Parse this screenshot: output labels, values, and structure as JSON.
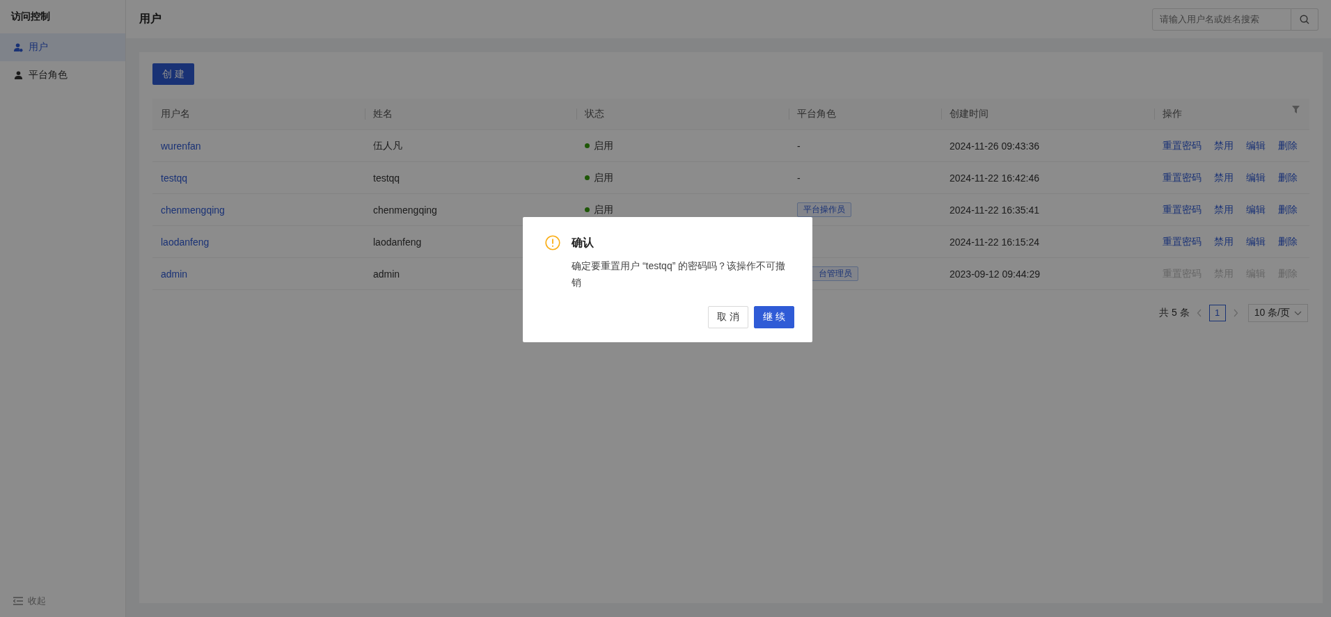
{
  "sidebar": {
    "title": "访问控制",
    "items": [
      {
        "label": "用户",
        "kind": "user",
        "selected": true
      },
      {
        "label": "平台角色",
        "kind": "role",
        "selected": false
      }
    ],
    "collapse": "收起"
  },
  "header": {
    "title": "用户",
    "search": {
      "placeholder": "请输入用户名或姓名搜索"
    }
  },
  "create_button": "创 建",
  "table": {
    "columns": [
      "用户名",
      "姓名",
      "状态",
      "平台角色",
      "创建时间",
      "操作"
    ],
    "rows": [
      {
        "username": "wurenfan",
        "name": "伍人凡",
        "status": "启用",
        "role": {
          "kind": "text",
          "label": "-"
        },
        "created": "2024-11-26 09:43:36",
        "actions": [
          {
            "label": "重置密码",
            "disabled": false
          },
          {
            "label": "禁用",
            "disabled": false
          },
          {
            "label": "编辑",
            "disabled": false
          },
          {
            "label": "删除",
            "disabled": false
          }
        ]
      },
      {
        "username": "testqq",
        "name": "testqq",
        "status": "启用",
        "role": {
          "kind": "text",
          "label": "-"
        },
        "created": "2024-11-22 16:42:46",
        "actions": [
          {
            "label": "重置密码",
            "disabled": false
          },
          {
            "label": "禁用",
            "disabled": false
          },
          {
            "label": "编辑",
            "disabled": false
          },
          {
            "label": "删除",
            "disabled": false
          }
        ]
      },
      {
        "username": "chenmengqing",
        "name": "chenmengqing",
        "status": "启用",
        "role": {
          "kind": "tag",
          "label": "平台操作员"
        },
        "created": "2024-11-22 16:35:41",
        "actions": [
          {
            "label": "重置密码",
            "disabled": false
          },
          {
            "label": "禁用",
            "disabled": false
          },
          {
            "label": "编辑",
            "disabled": false
          },
          {
            "label": "删除",
            "disabled": false
          }
        ]
      },
      {
        "username": "laodanfeng",
        "name": "laodanfeng",
        "created": "2024-11-22 16:15:24",
        "actions": [
          {
            "label": "重置密码",
            "disabled": false
          },
          {
            "label": "禁用",
            "disabled": false
          },
          {
            "label": "编辑",
            "disabled": false
          },
          {
            "label": "删除",
            "disabled": false
          }
        ]
      },
      {
        "username": "admin",
        "name": "admin",
        "role": {
          "kind": "clipped_tag",
          "label": "台管理员"
        },
        "created": "2023-09-12 09:44:29",
        "actions": [
          {
            "label": "重置密码",
            "disabled": true
          },
          {
            "label": "禁用",
            "disabled": true
          },
          {
            "label": "编辑",
            "disabled": true
          },
          {
            "label": "删除",
            "disabled": true
          }
        ]
      }
    ]
  },
  "pagination": {
    "total": "共 5 条",
    "pages": [
      {
        "label": "1",
        "selected": true
      }
    ],
    "page_size": "10 条/页"
  },
  "dialog": {
    "title": "确认",
    "message": "确定要重置用户 “testqq” 的密码吗？该操作不可撤销",
    "buttons": [
      {
        "label": "取 消",
        "kind": "default"
      },
      {
        "label": "继 续",
        "kind": "primary"
      }
    ]
  }
}
